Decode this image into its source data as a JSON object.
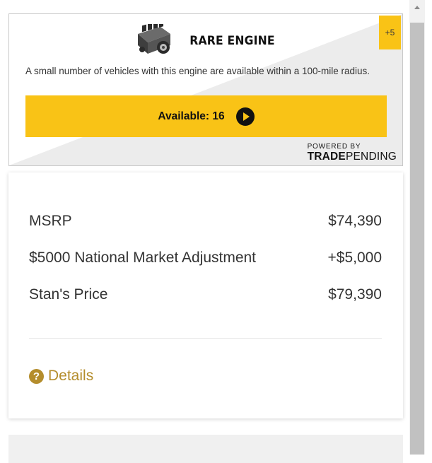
{
  "engine_card": {
    "title": "RARE ENGINE",
    "badge": "+5",
    "description": "A small number of vehicles with this engine are available within a 100-mile radius.",
    "available_label": "Available: 16",
    "powered_by": "POWERED BY",
    "brand_part1": "TRADE",
    "brand_part2": "PENDING",
    "accent_color": "#f9c316"
  },
  "pricing": {
    "rows": [
      {
        "label": "MSRP",
        "value": "$74,390"
      },
      {
        "label": "$5000 National Market Adjustment",
        "value": "+$5,000"
      },
      {
        "label": "Stan's Price",
        "value": "$79,390"
      }
    ],
    "details_label": "Details",
    "link_color": "#b48d2c"
  }
}
